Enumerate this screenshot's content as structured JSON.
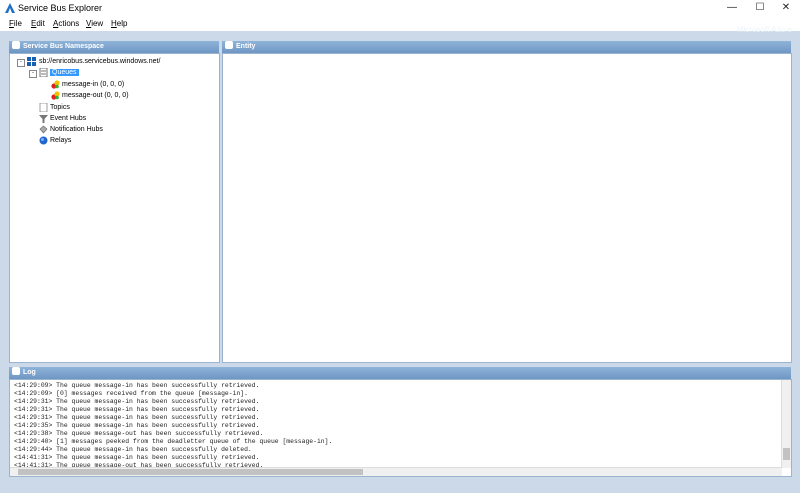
{
  "window": {
    "title": "Service Bus Explorer",
    "brand": "Microsoft Azure"
  },
  "menu": {
    "items": [
      {
        "u": "F",
        "rest": "ile"
      },
      {
        "u": "E",
        "rest": "dit"
      },
      {
        "u": "A",
        "rest": "ctions"
      },
      {
        "u": "V",
        "rest": "iew"
      },
      {
        "u": "H",
        "rest": "elp"
      }
    ]
  },
  "namespace_panel": {
    "title": "Service Bus Namespace",
    "root": "sb://enricobus.servicebus.windows.net/",
    "queues_label": "Queues",
    "queues": [
      "message-in (0, 0, 0)",
      "message-out (0, 0, 0)"
    ],
    "topics_label": "Topics",
    "event_hubs_label": "Event Hubs",
    "notification_hubs_label": "Notification Hubs",
    "relays_label": "Relays"
  },
  "entity_panel": {
    "title": "Entity"
  },
  "log_panel": {
    "title": "Log",
    "lines": [
      "<14:29:09> The queue message-in has been successfully retrieved.",
      "<14:29:09> [0] messages received from the queue [message-in].",
      "<14:29:31> The queue message-in has been successfully retrieved.",
      "<14:29:31> The queue message-in has been successfully retrieved.",
      "<14:29:31> The queue message-in has been successfully retrieved.",
      "<14:29:35> The queue message-in has been successfully retrieved.",
      "<14:29:38> The queue message-out has been successfully retrieved.",
      "<14:29:40> [1] messages peeked from the deadletter queue of the queue [message-in].",
      "<14:29:44> The queue message-in has been successfully deleted.",
      "<14:41:31> The queue message-in has been successfully retrieved.",
      "<14:41:31> The queue message-out has been successfully retrieved."
    ]
  },
  "colors": {
    "header": "#7aa0cc",
    "selection": "#3399ff",
    "frame": "#ccd9e8"
  }
}
